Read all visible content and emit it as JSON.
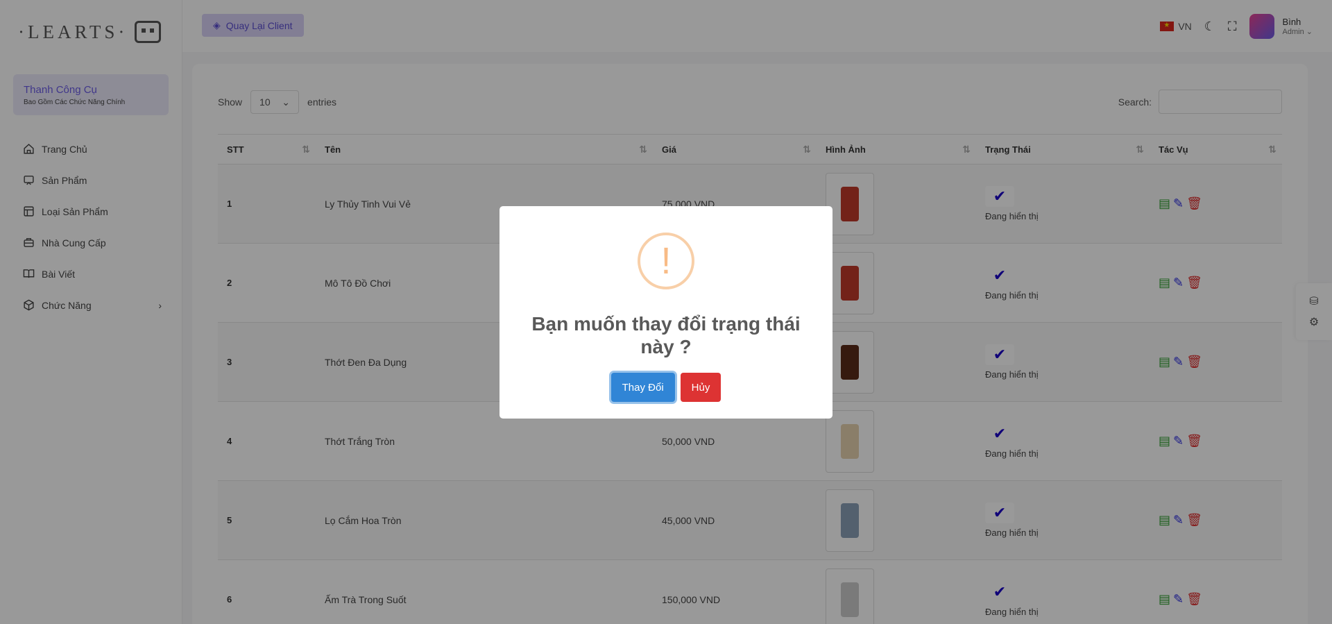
{
  "brand": {
    "logo_text": "·LEARTS·"
  },
  "header": {
    "back_label": "Quay Lại Client",
    "lang": "VN",
    "user_name": "Bình",
    "user_role": "Admin"
  },
  "sidebar": {
    "tools_title": "Thanh Công Cụ",
    "tools_sub": "Bao Gồm Các Chức Năng Chính",
    "items": [
      {
        "label": "Trang Chủ",
        "icon": "home-icon"
      },
      {
        "label": "Sản Phẩm",
        "icon": "product-icon"
      },
      {
        "label": "Loại Sản Phẩm",
        "icon": "category-icon"
      },
      {
        "label": "Nhà Cung Cấp",
        "icon": "supplier-icon"
      },
      {
        "label": "Bài Viết",
        "icon": "book-icon"
      },
      {
        "label": "Chức Năng",
        "icon": "box-icon"
      }
    ]
  },
  "table": {
    "show_label": "Show",
    "entries_value": "10",
    "entries_label": "entries",
    "search_label": "Search:",
    "columns": [
      "STT",
      "Tên",
      "Giá",
      "Hình Ảnh",
      "Trạng Thái",
      "Tác Vụ"
    ],
    "rows": [
      {
        "stt": "1",
        "name": "Ly Thủy Tinh Vui Vẻ",
        "price": "75,000 VND",
        "status": "Đang hiển thị",
        "thumb_color": "#c0392b"
      },
      {
        "stt": "2",
        "name": "Mô Tô Đồ Chơi",
        "price": "",
        "status": "Đang hiển thị",
        "thumb_color": "#c0392b"
      },
      {
        "stt": "3",
        "name": "Thớt Đen Đa Dụng",
        "price": "",
        "status": "Đang hiển thị",
        "thumb_color": "#5b2c1a"
      },
      {
        "stt": "4",
        "name": "Thớt Trắng Tròn",
        "price": "50,000 VND",
        "status": "Đang hiển thị",
        "thumb_color": "#e6d3b0"
      },
      {
        "stt": "5",
        "name": "Lọ Cắm Hoa Tròn",
        "price": "45,000 VND",
        "status": "Đang hiển thị",
        "thumb_color": "#8aa0b8"
      },
      {
        "stt": "6",
        "name": "Ấm Trà Trong Suốt",
        "price": "150,000 VND",
        "status": "Đang hiển thị",
        "thumb_color": "#cccccc"
      }
    ]
  },
  "modal": {
    "title": "Bạn muốn thay đổi trạng thái này ?",
    "confirm_label": "Thay Đổi",
    "cancel_label": "Hủy"
  }
}
